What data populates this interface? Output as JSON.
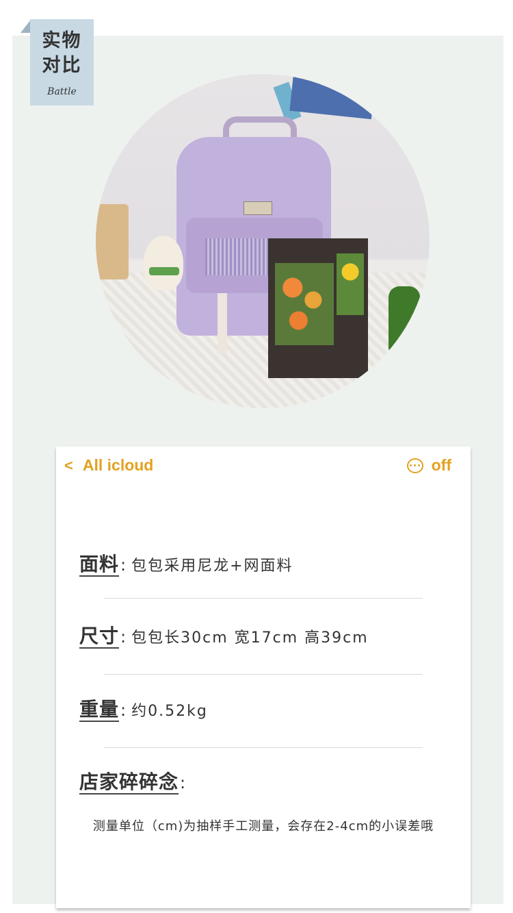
{
  "tag": {
    "title_line1": "实物",
    "title_line2": "对比",
    "subtitle": "Battle"
  },
  "topbar": {
    "back_label": "All icloud",
    "right_label": "off"
  },
  "specs": [
    {
      "key": "面料",
      "value": "包包采用尼龙+网面料"
    },
    {
      "key": "尺寸",
      "value": "包包长30cm 宽17cm 高39cm"
    },
    {
      "key": "重量",
      "value": "约0.52kg"
    },
    {
      "key": "店家碎碎念",
      "value": ""
    }
  ],
  "note": "测量单位（cm)为抽样手工测量，会存在2-4cm的小误差哦",
  "colors": {
    "accent": "#e3a122",
    "panel": "#eef2ef",
    "tag": "#c8d9e4"
  },
  "icons": [
    "chevron-left-icon",
    "more-dots-icon"
  ]
}
